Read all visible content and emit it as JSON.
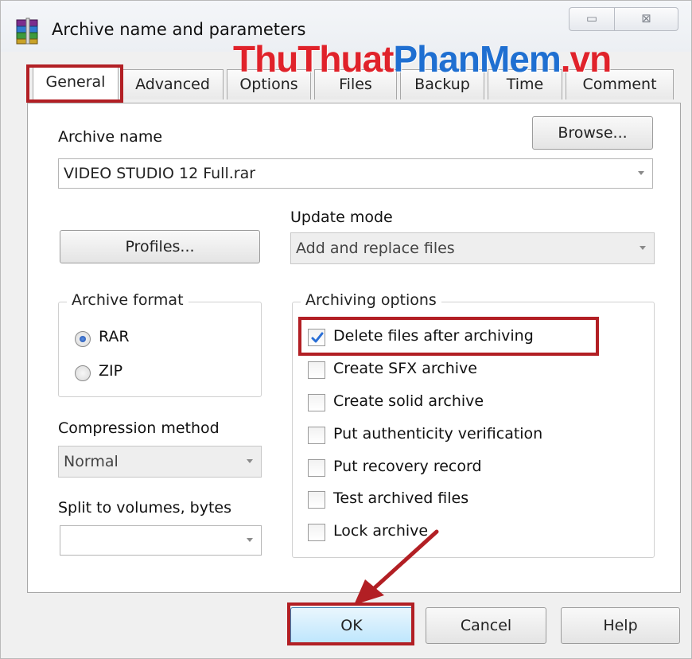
{
  "window": {
    "title": "Archive name and parameters",
    "min_glyph": "▭",
    "max_glyph": "⊠"
  },
  "watermark": {
    "part1": "ThuThuat",
    "part2": "PhanMem",
    "part3": ".vn",
    "color_red": "#e0222a",
    "color_blue": "#1f6fd1"
  },
  "tabs": [
    {
      "label": "General",
      "active": true
    },
    {
      "label": "Advanced"
    },
    {
      "label": "Options"
    },
    {
      "label": "Files"
    },
    {
      "label": "Backup"
    },
    {
      "label": "Time"
    },
    {
      "label": "Comment"
    }
  ],
  "archive_name": {
    "label": "Archive name",
    "value": "VIDEO STUDIO 12 Full.rar",
    "browse_label": "Browse..."
  },
  "update_mode": {
    "label": "Update mode",
    "value": "Add and replace files"
  },
  "profiles_label": "Profiles...",
  "archive_format": {
    "title": "Archive format",
    "options": [
      {
        "label": "RAR",
        "selected": true
      },
      {
        "label": "ZIP",
        "selected": false
      }
    ]
  },
  "compression": {
    "label": "Compression method",
    "value": "Normal"
  },
  "split": {
    "label": "Split to volumes, bytes",
    "value": ""
  },
  "archiving_options": {
    "title": "Archiving options",
    "items": [
      {
        "label": "Delete files after archiving",
        "checked": true
      },
      {
        "label": "Create SFX archive",
        "checked": false
      },
      {
        "label": "Create solid archive",
        "checked": false
      },
      {
        "label": "Put authenticity verification",
        "checked": false
      },
      {
        "label": "Put recovery record",
        "checked": false
      },
      {
        "label": "Test archived files",
        "checked": false
      },
      {
        "label": "Lock archive",
        "checked": false
      }
    ]
  },
  "buttons": {
    "ok": "OK",
    "cancel": "Cancel",
    "help": "Help"
  },
  "highlight_color": "#b21f24",
  "check_color": "#2a6fd6"
}
